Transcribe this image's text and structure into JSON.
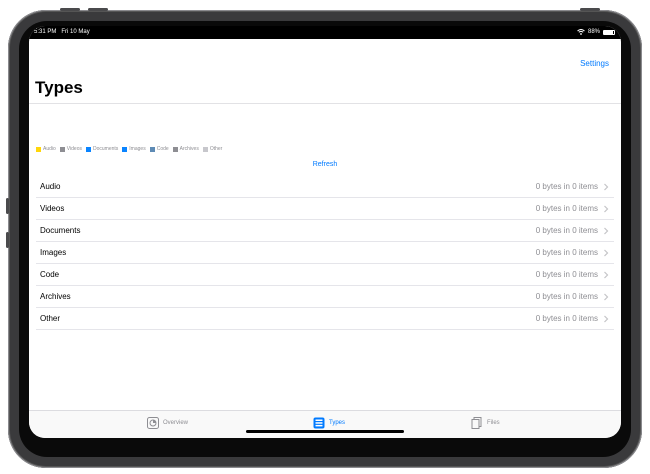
{
  "status_bar": {
    "time": "5:31 PM",
    "date": "Fri 10 May",
    "battery_percent": "88%",
    "battery_level": 0.88
  },
  "nav": {
    "settings_label": "Settings",
    "title": "Types"
  },
  "legend": [
    {
      "label": "Audio",
      "color": "#ffd60a"
    },
    {
      "label": "Videos",
      "color": "#8e8e93"
    },
    {
      "label": "Documents",
      "color": "#0a84ff"
    },
    {
      "label": "Images",
      "color": "#0a84ff"
    },
    {
      "label": "Code",
      "color": "#5e8bb5"
    },
    {
      "label": "Archives",
      "color": "#8e8e93"
    },
    {
      "label": "Other",
      "color": "#c7c7cc"
    }
  ],
  "refresh_label": "Refresh",
  "types": [
    {
      "label": "Audio",
      "value": "0 bytes in 0 items"
    },
    {
      "label": "Videos",
      "value": "0 bytes in 0 items"
    },
    {
      "label": "Documents",
      "value": "0 bytes in 0 items"
    },
    {
      "label": "Images",
      "value": "0 bytes in 0 items"
    },
    {
      "label": "Code",
      "value": "0 bytes in 0 items"
    },
    {
      "label": "Archives",
      "value": "0 bytes in 0 items"
    },
    {
      "label": "Other",
      "value": "0 bytes in 0 items"
    }
  ],
  "tabs": [
    {
      "label": "Overview",
      "icon": "overview-icon",
      "active": false
    },
    {
      "label": "Types",
      "icon": "types-icon",
      "active": true
    },
    {
      "label": "Files",
      "icon": "files-icon",
      "active": false
    }
  ],
  "colors": {
    "accent": "#007aff",
    "secondary_text": "#8e8e93"
  }
}
